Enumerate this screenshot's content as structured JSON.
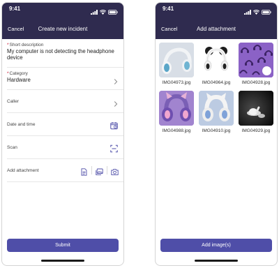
{
  "left": {
    "status": {
      "time": "9:41"
    },
    "nav": {
      "cancel": "Cancel",
      "title": "Create new incident"
    },
    "fields": {
      "short_description": {
        "label": "Short description",
        "value": "My computer is not detecting the headphone device"
      },
      "category": {
        "label": "Category",
        "value": "Hardware"
      },
      "caller": {
        "label": "Caller"
      },
      "date_time": {
        "label": "Date and time"
      },
      "scan": {
        "label": "Scan"
      },
      "attachment": {
        "label": "Add attachment"
      }
    },
    "submit": "Submit"
  },
  "right": {
    "status": {
      "time": "9:41"
    },
    "nav": {
      "cancel": "Cancel",
      "title": "Add attachment"
    },
    "images": [
      {
        "name": "IMG04973.jpg",
        "selected": false
      },
      {
        "name": "IMG04964.jpg",
        "selected": false
      },
      {
        "name": "IMG04928.jpg",
        "selected": true
      },
      {
        "name": "IMG04988.jpg",
        "selected": false
      },
      {
        "name": "IMG04910.jpg",
        "selected": false
      },
      {
        "name": "IMG04929.jpg",
        "selected": false
      }
    ],
    "add_button": "Add image(s)"
  },
  "colors": {
    "header": "#2f2b4f",
    "accent": "#4f4ea8",
    "required": "#c8102e"
  },
  "icons": [
    "chevron-right-icon",
    "calendar-icon",
    "scan-icon",
    "document-icon",
    "gallery-icon",
    "camera-icon",
    "checkmark-icon"
  ]
}
